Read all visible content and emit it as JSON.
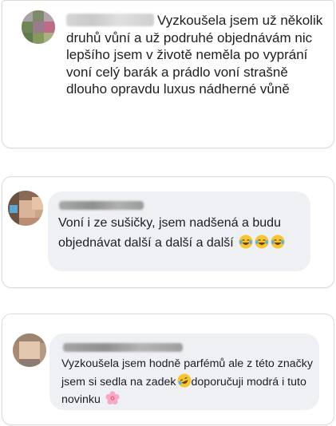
{
  "comments": [
    {
      "author_name": "",
      "text": "Vyzkoušela jsem už několik druhů vůní a už podruhé objednávám nic lepšího jsem v životě neměla po vyprání voní celý barák a prádlo voní strašně dlouho opravdu luxus  nádherné vůně"
    },
    {
      "author_name": "",
      "text": "Voní i ze sušičky, jsem nadšená a budu objednávat další a další a další",
      "emojis": [
        "laughing-tears-emoji",
        "laughing-tears-emoji",
        "laughing-tears-emoji"
      ]
    },
    {
      "author_name": "",
      "text": "Vyzkoušela jsem hodně parfémů ale z této značky jsem si sedla na zadek",
      "text_after": "doporučuji modrá i tuto novinku",
      "emojis": [
        "rofl-emoji",
        "cherry-blossom-emoji"
      ]
    }
  ],
  "colors": {
    "bubble_bg": "#eef0f3",
    "card_border": "#dcdcdc",
    "text": "#1c1e21"
  }
}
